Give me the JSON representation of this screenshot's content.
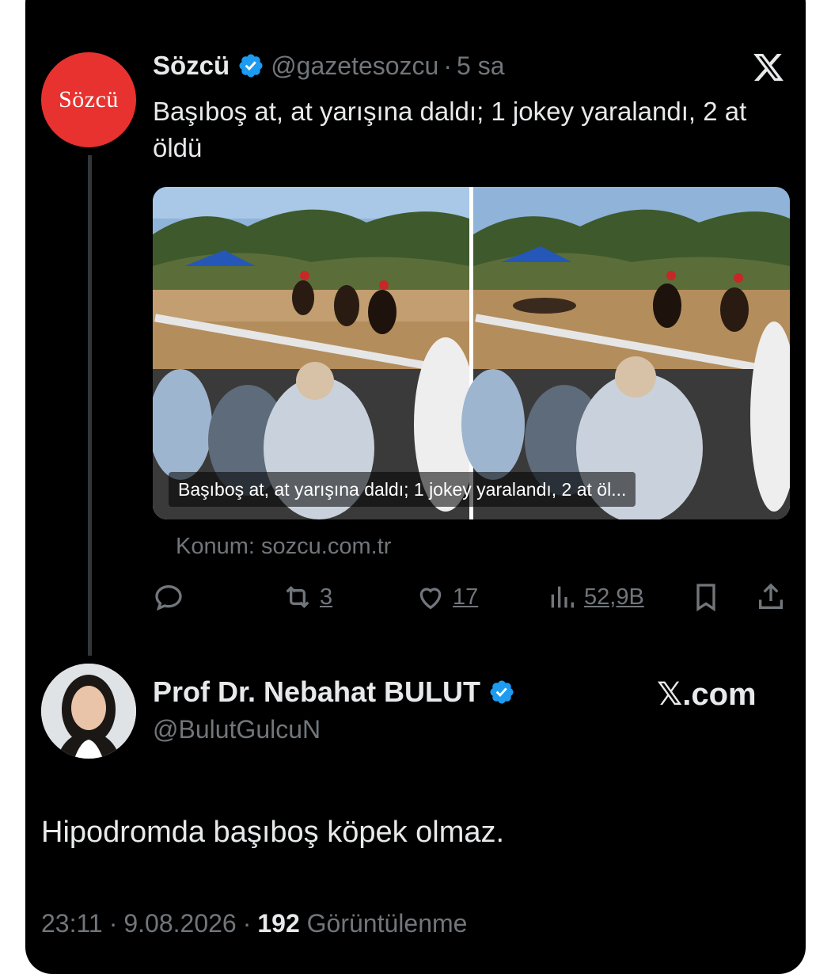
{
  "original_tweet": {
    "avatar_text": "Sözcü",
    "display_name": "Sözcü",
    "handle": "@gazetesozcu",
    "time_ago": "5 sa",
    "text": "Başıboş at, at yarışına daldı; 1 jokey yaralandı, 2 at öldü",
    "media_caption": "Başıboş at, at yarışına daldı; 1 jokey yaralandı, 2 at öl...",
    "location": "Konum: sozcu.com.tr",
    "actions": {
      "reply_icon": "reply-icon",
      "retweet_count": "3",
      "like_count": "17",
      "views_count": "52,9B",
      "bookmark_icon": "bookmark-icon",
      "share_icon": "share-icon"
    }
  },
  "reply": {
    "display_name": "Prof Dr. Nebahat BULUT",
    "handle": "@BulutGulcuN",
    "text": "Hipodromda başıboş köpek olmaz.",
    "watermark": "𝕏.com",
    "footer": {
      "time": "23:11",
      "date": "9.08.2026",
      "views_number": "192",
      "views_label": "Görüntülenme"
    }
  },
  "colors": {
    "background": "#000000",
    "text_primary": "#e7e9ea",
    "text_secondary": "#71767b",
    "verified": "#1d9bf0",
    "sozcu_red": "#e7322f"
  }
}
